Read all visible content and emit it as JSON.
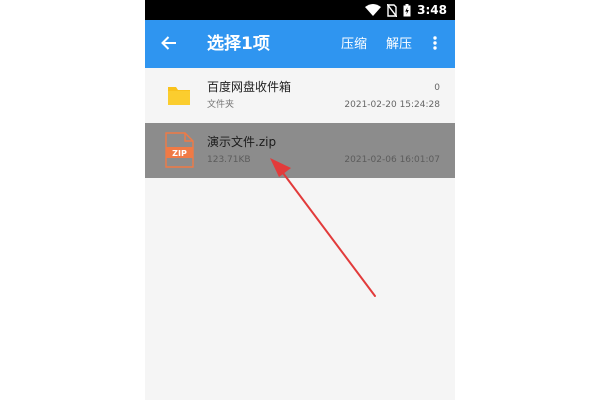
{
  "status_bar": {
    "time": "3:48",
    "icons": [
      "wifi-icon",
      "sim-off-icon",
      "battery-charging-icon"
    ]
  },
  "app_bar": {
    "back_icon": "arrow-back-icon",
    "title": "选择1项",
    "compress_label": "压缩",
    "extract_label": "解压",
    "more_icon": "more-vert-icon",
    "color": "#2f95f0"
  },
  "files": [
    {
      "icon": "folder-icon",
      "name": "百度网盘收件箱",
      "sub": "文件夹",
      "count": "0",
      "date": "2021-02-20 15:24:28",
      "selected": false
    },
    {
      "icon": "zip-file-icon",
      "icon_label": "ZIP",
      "name": "演示文件.zip",
      "sub": "123.71KB",
      "count": "",
      "date": "2021-02-06 16:01:07",
      "selected": true
    }
  ],
  "colors": {
    "selected_row": "#8c8c8c",
    "folder": "#f9c21c",
    "zip": "#f07a45",
    "annotation_arrow": "#e23b3b"
  }
}
